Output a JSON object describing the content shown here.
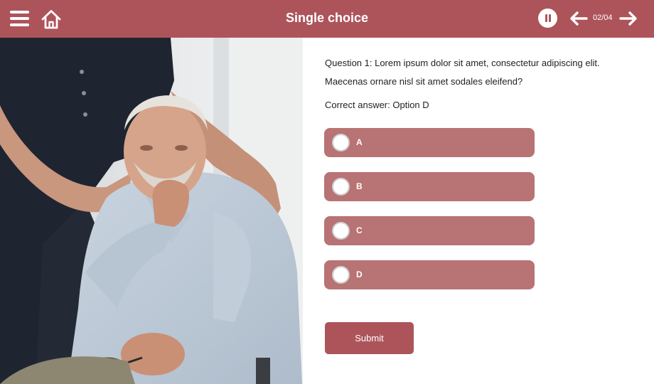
{
  "header": {
    "title": "Single choice",
    "counter": "02/04",
    "icons": {
      "menu": "hamburger-menu-icon",
      "home": "home-icon",
      "pause": "pause-icon",
      "prev": "arrow-left-icon",
      "next": "arrow-right-icon"
    }
  },
  "question": {
    "line1": "Question 1: Lorem ipsum dolor sit amet, consectetur adipiscing elit.",
    "line2": "Maecenas ornare nisl sit amet sodales eleifend?",
    "correct_answer": "Correct answer: Option D"
  },
  "options": [
    {
      "label": "A"
    },
    {
      "label": "B"
    },
    {
      "label": "C"
    },
    {
      "label": "D"
    }
  ],
  "submit_label": "Submit",
  "colors": {
    "brand": "#ad545b",
    "option_bg": "#b87374",
    "text": "#222222"
  }
}
